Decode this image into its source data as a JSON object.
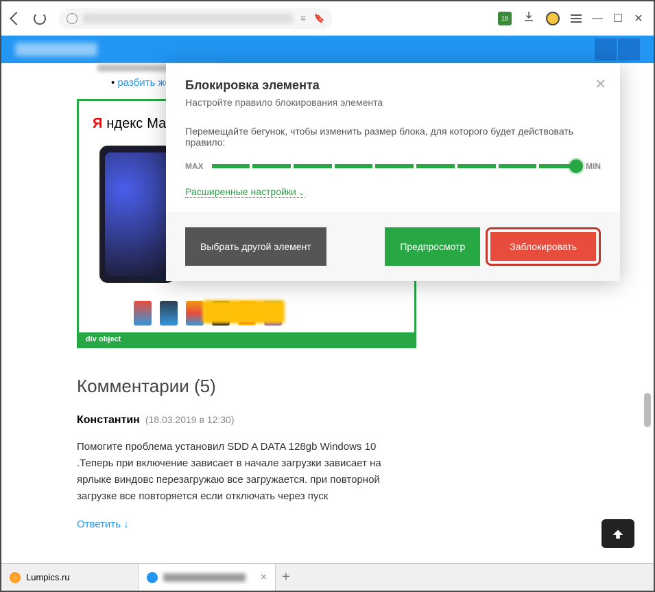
{
  "toolbar": {
    "ext_badge": "18"
  },
  "page": {
    "link_text": "разбить жестк",
    "yandex_ya": "Я",
    "yandex_ndex": "ндекс",
    "yandex_market": "Маркет",
    "div_label": "div object"
  },
  "dialog": {
    "title": "Блокировка элемента",
    "subtitle": "Настройте правило блокирования элемента",
    "instruction": "Перемещайте бегунок, чтобы изменить размер блока, для которого будет действовать правило:",
    "max_label": "MAX",
    "min_label": "MIN",
    "advanced_link": "Расширенные настройки",
    "btn_pick": "Выбрать другой элемент",
    "btn_preview": "Предпросмотр",
    "btn_block": "Заблокировать"
  },
  "comments": {
    "title": "Комментарии (5)",
    "author": "Константин",
    "date": "(18.03.2019 в 12:30)",
    "text": "Помогите проблема установил SDD A DATA 128gb Windows 10 .Теперь при включение зависает в начале загрузки зависает на ярлыке виндовс перезагружаю все загружается. при повторной загрузке все повторяется если отключать через пуск",
    "reply": "Ответить ↓"
  },
  "tabs": {
    "tab1": "Lumpics.ru"
  }
}
